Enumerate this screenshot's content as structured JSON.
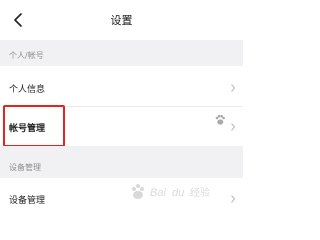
{
  "header": {
    "title": "设置",
    "back_icon": "chevron-left-icon"
  },
  "sections": [
    {
      "header": "个人/帐号",
      "items": [
        {
          "label": "个人信息",
          "icon": "chevron-right-icon"
        },
        {
          "label": "帐号管理",
          "icon": "chevron-right-icon",
          "badge_icon": "paw-icon"
        }
      ]
    },
    {
      "header": "设备管理",
      "items": [
        {
          "label": "设备管理",
          "icon": "chevron-right-icon"
        }
      ]
    }
  ],
  "highlight_color": "#e8221e",
  "watermark": "Baidu 经验",
  "watermark_icon": "baidu-paw-logo"
}
